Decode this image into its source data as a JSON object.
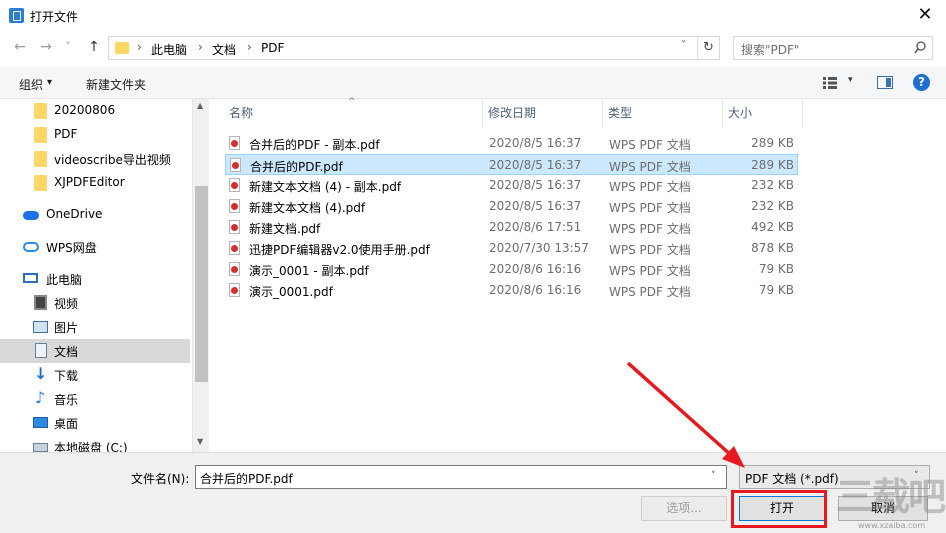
{
  "window": {
    "title": "打开文件",
    "close_glyph": "✕"
  },
  "nav": {
    "back": "←",
    "forward": "→",
    "history": "˅",
    "up": "↑"
  },
  "address": {
    "crumbs": [
      "此电脑",
      "文档",
      "PDF"
    ],
    "separator": "›",
    "dropdown": "˅",
    "refresh": "↻"
  },
  "search": {
    "placeholder": "搜索\"PDF\""
  },
  "toolbar": {
    "organize": "组织",
    "organize_dd": "▾",
    "new_folder": "新建文件夹",
    "view_dd": "▾",
    "help": "?"
  },
  "sidebar": {
    "items": [
      {
        "label": "20200806",
        "icon": "folder-icon"
      },
      {
        "label": "PDF",
        "icon": "folder-icon"
      },
      {
        "label": "videoscribe导出视频",
        "icon": "folder-icon"
      },
      {
        "label": "XJPDFEditor",
        "icon": "folder-icon"
      },
      {
        "label": "OneDrive",
        "icon": "onedrive-icon"
      },
      {
        "label": "WPS网盘",
        "icon": "wps-cloud-icon"
      },
      {
        "label": "此电脑",
        "icon": "computer-icon"
      },
      {
        "label": "视频",
        "icon": "video-icon"
      },
      {
        "label": "图片",
        "icon": "picture-icon"
      },
      {
        "label": "文档",
        "icon": "document-icon",
        "selected": true
      },
      {
        "label": "下载",
        "icon": "download-icon"
      },
      {
        "label": "音乐",
        "icon": "music-icon"
      },
      {
        "label": "桌面",
        "icon": "desktop-icon"
      },
      {
        "label": "本地磁盘 (C:)",
        "icon": "disk-icon"
      }
    ],
    "scroll_up": "▲",
    "scroll_down": "▼"
  },
  "columns": {
    "name": "名称",
    "modified": "修改日期",
    "type": "类型",
    "size": "大小",
    "sort_caret": "^"
  },
  "files": [
    {
      "name": "合并后的PDF - 副本.pdf",
      "modified": "2020/8/5 16:37",
      "type": "WPS PDF 文档",
      "size": "289 KB"
    },
    {
      "name": "合并后的PDF.pdf",
      "modified": "2020/8/5 16:37",
      "type": "WPS PDF 文档",
      "size": "289 KB",
      "selected": true
    },
    {
      "name": "新建文本文档 (4) - 副本.pdf",
      "modified": "2020/8/5 16:37",
      "type": "WPS PDF 文档",
      "size": "232 KB"
    },
    {
      "name": "新建文本文档 (4).pdf",
      "modified": "2020/8/5 16:37",
      "type": "WPS PDF 文档",
      "size": "232 KB"
    },
    {
      "name": "新建文档.pdf",
      "modified": "2020/8/6 17:51",
      "type": "WPS PDF 文档",
      "size": "492 KB"
    },
    {
      "name": "迅捷PDF编辑器v2.0使用手册.pdf",
      "modified": "2020/7/30 13:57",
      "type": "WPS PDF 文档",
      "size": "878 KB"
    },
    {
      "name": "演示_0001 - 副本.pdf",
      "modified": "2020/8/6 16:16",
      "type": "WPS PDF 文档",
      "size": "79 KB"
    },
    {
      "name": "演示_0001.pdf",
      "modified": "2020/8/6 16:16",
      "type": "WPS PDF 文档",
      "size": "79 KB"
    }
  ],
  "footer": {
    "filename_label": "文件名(N):",
    "filename_value": "合并后的PDF.pdf",
    "filetype_value": "PDF 文档 (*.pdf)",
    "dropdown": "˅",
    "options_button": "选项...",
    "open_button": "打开",
    "cancel_button": "取消"
  },
  "watermark": {
    "text": "三载吧",
    "sub": "www.xzaiba.com"
  },
  "colors": {
    "accent": "#0078d7",
    "selection": "#cce8ff",
    "annotation_red": "#e8181f"
  }
}
